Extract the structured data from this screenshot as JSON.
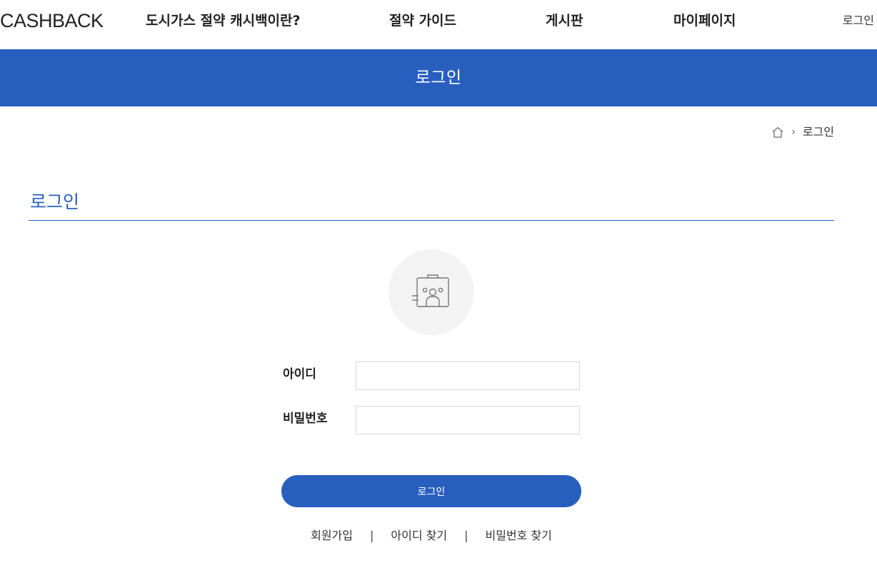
{
  "header": {
    "logo": "CASHBACK",
    "nav": [
      {
        "label": "도시가스 절약 캐시백이란?"
      },
      {
        "label": "절약 가이드"
      },
      {
        "label": "게시판"
      },
      {
        "label": "마이페이지"
      }
    ],
    "login_link": "로그인"
  },
  "banner": {
    "title": "로그인"
  },
  "breadcrumb": {
    "separator": "›",
    "current": "로그인"
  },
  "page": {
    "title": "로그인"
  },
  "form": {
    "id_label": "아이디",
    "id_value": "",
    "password_label": "비밀번호",
    "password_value": "",
    "submit_label": "로그인"
  },
  "links": {
    "signup": "회원가입",
    "find_id": "아이디 찾기",
    "find_password": "비밀번호 찾기",
    "separator": "|"
  },
  "colors": {
    "accent": "#285fbf",
    "avatar_bg": "#f3f3f3",
    "icon": "#777777"
  },
  "icons": {
    "home": "home-icon",
    "avatar": "id-card-icon"
  }
}
